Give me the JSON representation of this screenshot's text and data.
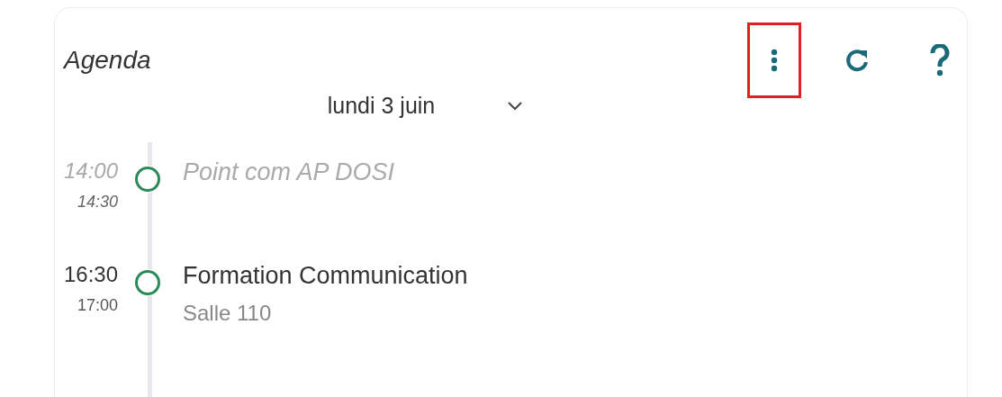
{
  "header": {
    "title": "Agenda",
    "buttons": [
      {
        "kind": "menu",
        "highlighted": true
      },
      {
        "kind": "refresh",
        "highlighted": false
      },
      {
        "kind": "help",
        "highlighted": false
      }
    ]
  },
  "date_picker": {
    "value": "lundi 3 juin"
  },
  "events": [
    {
      "start": "14:00",
      "end": "14:30",
      "title": "Point com AP DOSI",
      "past": true
    },
    {
      "start": "16:30",
      "end": "17:00",
      "title": "Formation Communication",
      "location": "Salle 110",
      "past": false
    }
  ]
}
